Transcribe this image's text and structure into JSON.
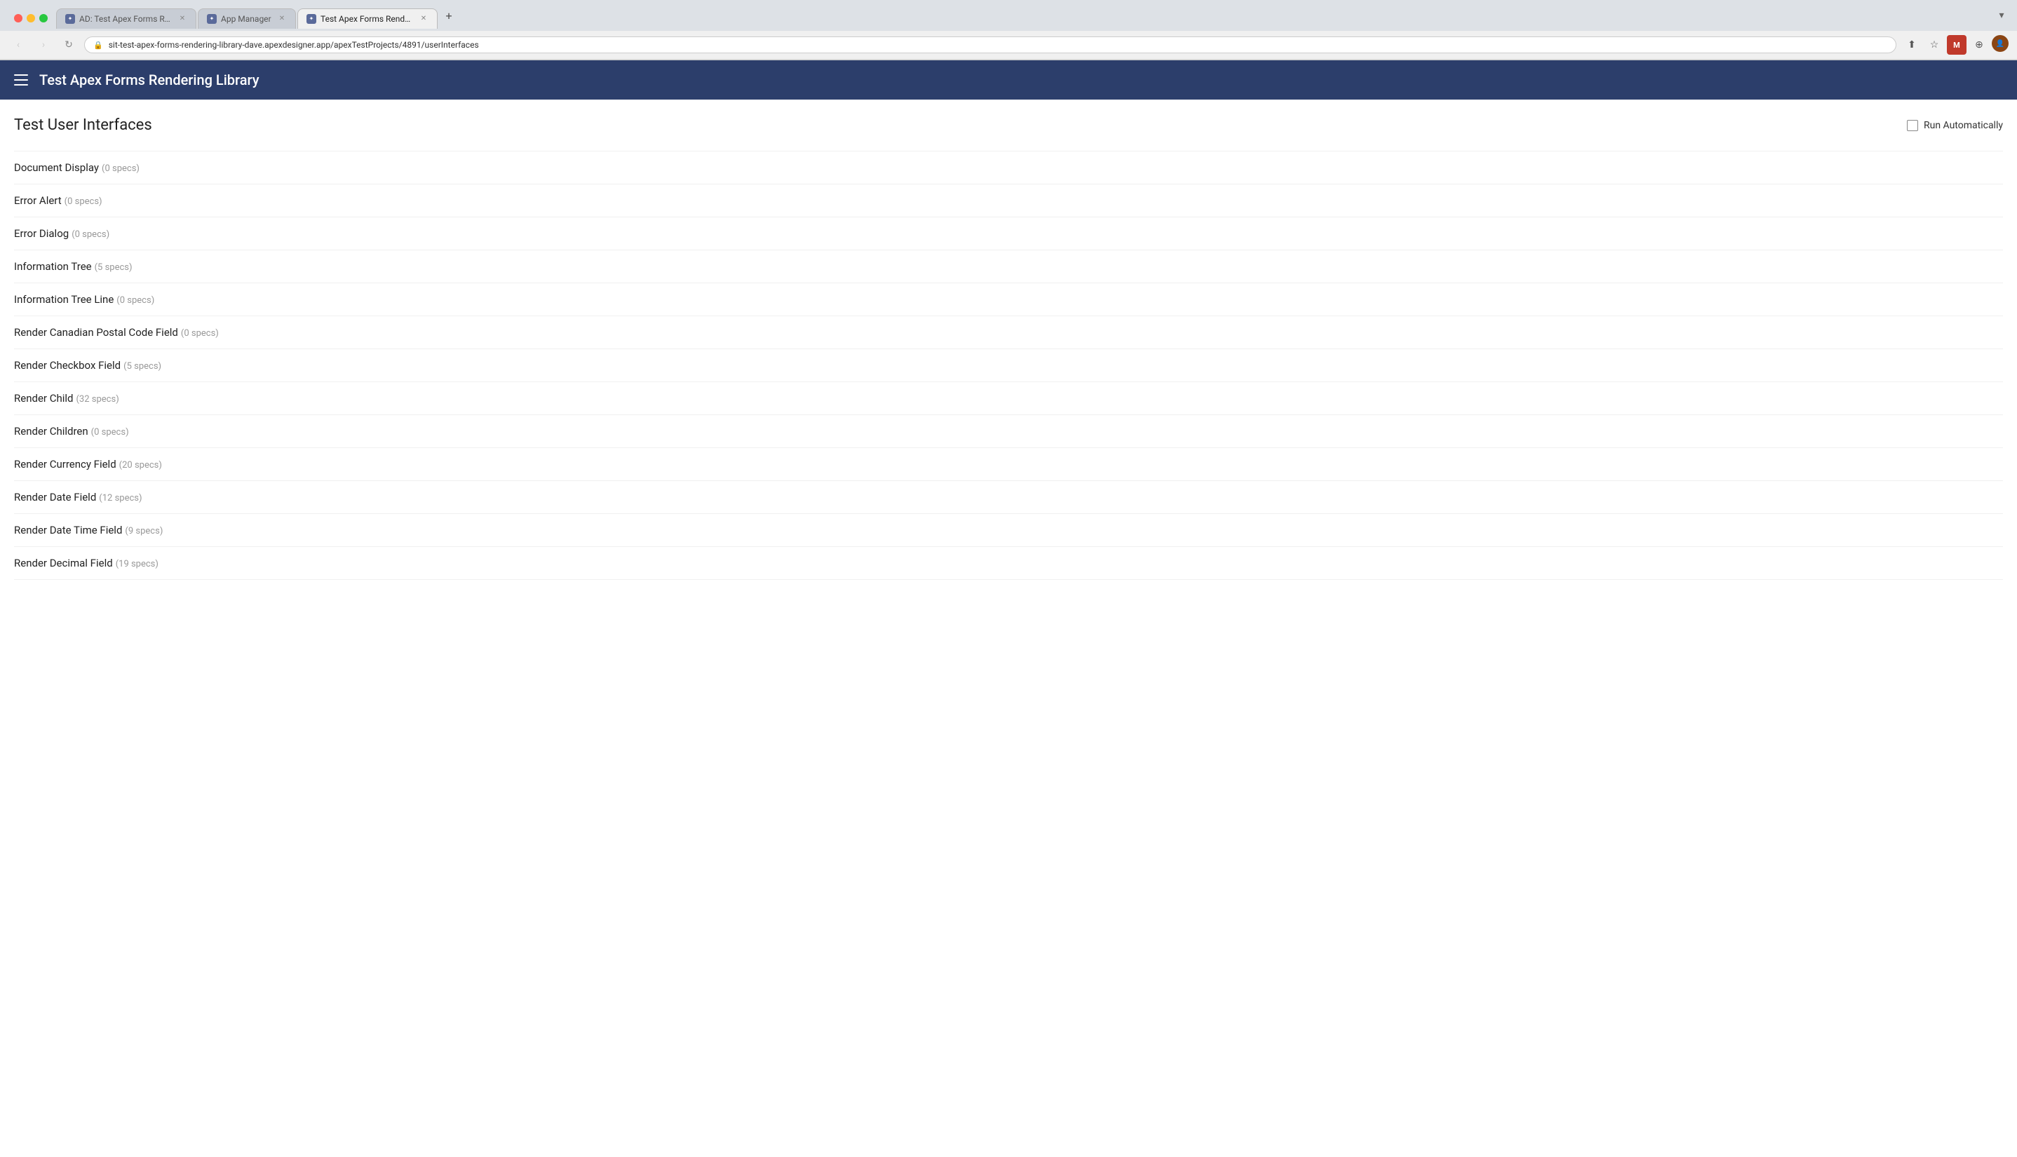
{
  "browser": {
    "tabs": [
      {
        "id": "tab1",
        "label": "AD: Test Apex Forms Renderin...",
        "active": false,
        "icon": "apex-icon"
      },
      {
        "id": "tab2",
        "label": "App Manager",
        "active": false,
        "icon": "apex-icon"
      },
      {
        "id": "tab3",
        "label": "Test Apex Forms Rendering Li...",
        "active": true,
        "icon": "apex-icon"
      }
    ],
    "address": "sit-test-apex-forms-rendering-library-dave.apexdesigner.app/apexTestProjects/4891/userInterfaces",
    "new_tab_label": "+",
    "back_label": "‹",
    "forward_label": "›",
    "refresh_label": "↻"
  },
  "app": {
    "title": "Test Apex Forms Rendering Library",
    "menu_icon": "hamburger-icon"
  },
  "page": {
    "title": "Test User Interfaces",
    "run_automatically_label": "Run Automatically"
  },
  "interfaces": [
    {
      "name": "Document Display",
      "specs": "(0 specs)"
    },
    {
      "name": "Error Alert",
      "specs": "(0 specs)"
    },
    {
      "name": "Error Dialog",
      "specs": "(0 specs)"
    },
    {
      "name": "Information Tree",
      "specs": "(5 specs)"
    },
    {
      "name": "Information Tree Line",
      "specs": "(0 specs)"
    },
    {
      "name": "Render Canadian Postal Code Field",
      "specs": "(0 specs)"
    },
    {
      "name": "Render Checkbox Field",
      "specs": "(5 specs)"
    },
    {
      "name": "Render Child",
      "specs": "(32 specs)"
    },
    {
      "name": "Render Children",
      "specs": "(0 specs)"
    },
    {
      "name": "Render Currency Field",
      "specs": "(20 specs)"
    },
    {
      "name": "Render Date Field",
      "specs": "(12 specs)"
    },
    {
      "name": "Render Date Time Field",
      "specs": "(9 specs)"
    },
    {
      "name": "Render Decimal Field",
      "specs": "(19 specs)"
    }
  ]
}
